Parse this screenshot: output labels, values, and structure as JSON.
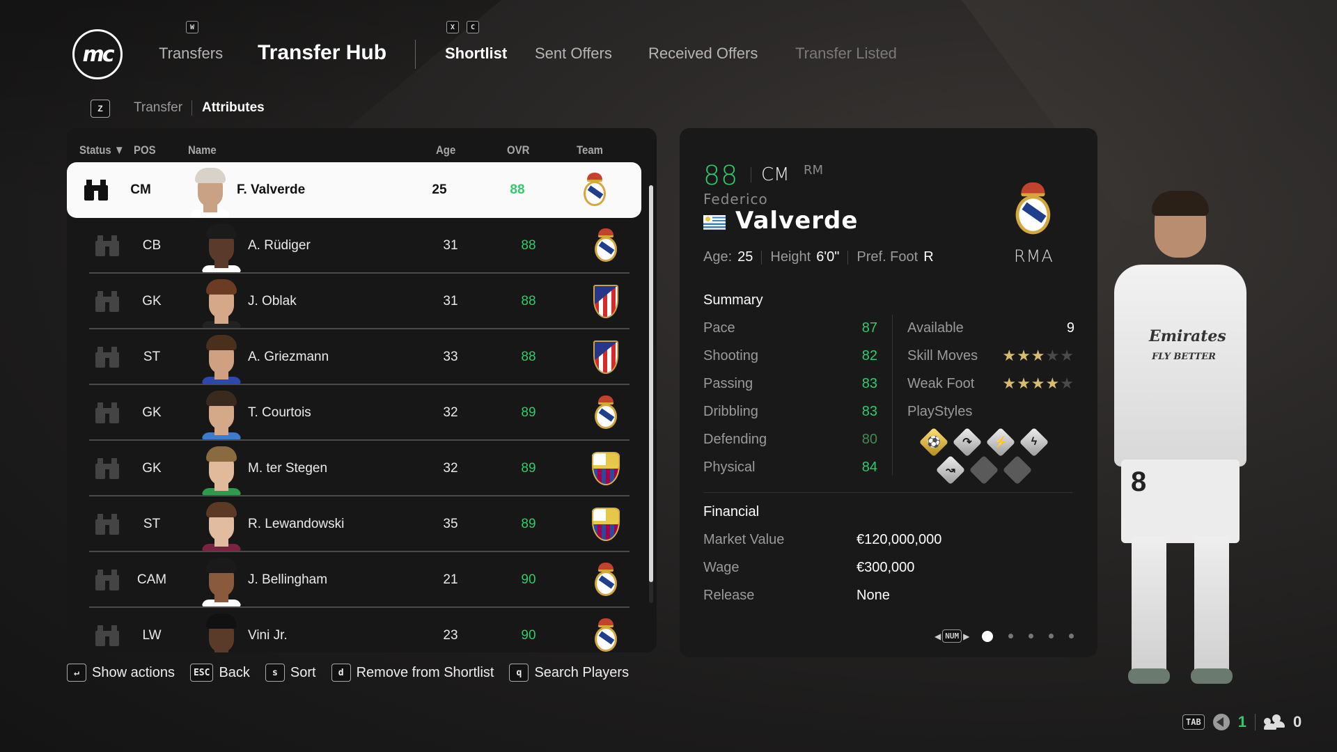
{
  "nav": {
    "logo_text": "mc",
    "key_w": "W",
    "key_x": "X",
    "key_c": "C",
    "transfers": "Transfers",
    "transfer_hub": "Transfer Hub",
    "tabs": [
      {
        "label": "Shortlist",
        "state": "active"
      },
      {
        "label": "Sent Offers",
        "state": "normal"
      },
      {
        "label": "Received Offers",
        "state": "normal"
      },
      {
        "label": "Transfer Listed",
        "state": "disabled"
      }
    ]
  },
  "subtabs": {
    "key": "Z",
    "items": [
      {
        "label": "Transfer",
        "active": false
      },
      {
        "label": "Attributes",
        "active": true
      }
    ]
  },
  "table": {
    "columns": {
      "status": "Status",
      "sort_indicator": "▼",
      "pos": "POS",
      "name": "Name",
      "age": "Age",
      "ovr": "OVR",
      "team": "Team"
    },
    "rows": [
      {
        "pos": "CM",
        "name": "F. Valverde",
        "age": "25",
        "ovr": "88",
        "team": "Real Madrid",
        "selected": true
      },
      {
        "pos": "CB",
        "name": "A. Rüdiger",
        "age": "31",
        "ovr": "88",
        "team": "Real Madrid"
      },
      {
        "pos": "GK",
        "name": "J. Oblak",
        "age": "31",
        "ovr": "88",
        "team": "Atlético de Madrid"
      },
      {
        "pos": "ST",
        "name": "A. Griezmann",
        "age": "33",
        "ovr": "88",
        "team": "Atlético de Madrid"
      },
      {
        "pos": "GK",
        "name": "T. Courtois",
        "age": "32",
        "ovr": "89",
        "team": "Real Madrid"
      },
      {
        "pos": "GK",
        "name": "M. ter Stegen",
        "age": "32",
        "ovr": "89",
        "team": "FC Barcelona"
      },
      {
        "pos": "ST",
        "name": "R. Lewandowski",
        "age": "35",
        "ovr": "89",
        "team": "FC Barcelona"
      },
      {
        "pos": "CAM",
        "name": "J. Bellingham",
        "age": "21",
        "ovr": "90",
        "team": "Real Madrid"
      },
      {
        "pos": "LW",
        "name": "Vini Jr.",
        "age": "23",
        "ovr": "90",
        "team": "Real Madrid"
      }
    ]
  },
  "detail": {
    "ovr": "88",
    "position": "CM",
    "alt_position": "RM",
    "first_name": "Federico",
    "last_name": "Valverde",
    "nationality": "Uruguay",
    "age_label": "Age:",
    "age": "25",
    "height_label": "Height",
    "height": "6'0\"",
    "foot_label": "Pref. Foot",
    "foot": "R",
    "club": "RMA",
    "summary_title": "Summary",
    "stats": [
      {
        "label": "Pace",
        "value": "87"
      },
      {
        "label": "Shooting",
        "value": "82"
      },
      {
        "label": "Passing",
        "value": "83"
      },
      {
        "label": "Dribbling",
        "value": "83"
      },
      {
        "label": "Defending",
        "value": "80"
      },
      {
        "label": "Physical",
        "value": "84"
      }
    ],
    "available_label": "Available",
    "available": "9",
    "skill_moves_label": "Skill Moves",
    "skill_moves": 3,
    "weak_foot_label": "Weak Foot",
    "weak_foot": 4,
    "star_max": 5,
    "playstyles_label": "PlayStyles",
    "playstyles": [
      {
        "name": "power-shot-plus",
        "tier": "gold",
        "glyph": "⚽"
      },
      {
        "name": "long-ball-pass",
        "tier": "silver",
        "glyph": "↷"
      },
      {
        "name": "tiki-taka",
        "tier": "silver",
        "glyph": "⚡"
      },
      {
        "name": "relentless",
        "tier": "silver",
        "glyph": "ϟ"
      },
      {
        "name": "whipped-pass",
        "tier": "silver",
        "glyph": "↝"
      },
      {
        "name": "empty",
        "tier": "empty",
        "glyph": ""
      },
      {
        "name": "empty",
        "tier": "empty",
        "glyph": ""
      }
    ],
    "financial_title": "Financial",
    "financial": [
      {
        "label": "Market Value",
        "value": "€120,000,000"
      },
      {
        "label": "Wage",
        "value": "€300,000"
      },
      {
        "label": "Release",
        "value": "None"
      }
    ],
    "pager_key": "NUM",
    "pages": 5,
    "current_page": 1
  },
  "player_model": {
    "sponsor": "Emirates",
    "sponsor_sub": "FLY BETTER",
    "number": "8"
  },
  "actions": [
    {
      "key": "↵",
      "label": "Show actions"
    },
    {
      "key": "ESC",
      "label": "Back"
    },
    {
      "key": "s",
      "label": "Sort"
    },
    {
      "key": "d",
      "label": "Remove from Shortlist"
    },
    {
      "key": "q",
      "label": "Search Players"
    }
  ],
  "footer": {
    "tab_key": "TAB",
    "voice_count": "1",
    "players_count": "0"
  },
  "colors": {
    "accent_green": "#2ecc6a",
    "star_gold": "#d9bb6e"
  }
}
